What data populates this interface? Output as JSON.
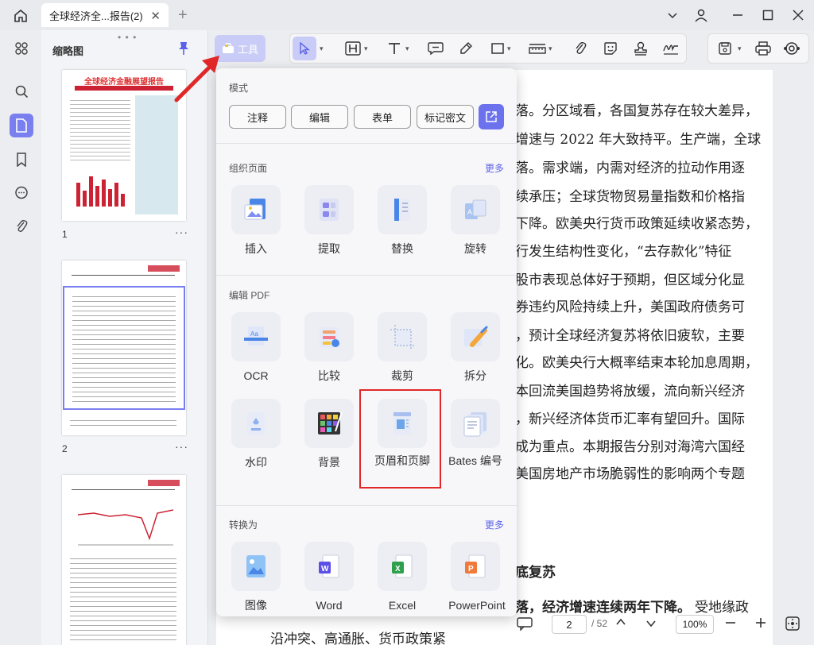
{
  "window": {
    "tab_title": "全球经济全...报告(2)",
    "tab_close": "✕",
    "new_tab": "+"
  },
  "thumbnails": {
    "title": "缩略图",
    "pages": [
      {
        "number": "1",
        "heading": "全球经济金融展望报告"
      },
      {
        "number": "2",
        "heading": ""
      },
      {
        "number": "",
        "heading": ""
      }
    ],
    "more": "···"
  },
  "toolbar": {
    "tools_label": "工具"
  },
  "dropdown": {
    "mode_label": "模式",
    "modes": [
      "注释",
      "编辑",
      "表单",
      "标记密文"
    ],
    "organize": {
      "label": "组织页面",
      "more": "更多",
      "items": [
        "插入",
        "提取",
        "替换",
        "旋转"
      ]
    },
    "edit": {
      "label": "编辑 PDF",
      "items": [
        "OCR",
        "比较",
        "裁剪",
        "拆分",
        "水印",
        "背景",
        "页眉和页脚",
        "Bates 编号"
      ]
    },
    "convert": {
      "label": "转换为",
      "more": "更多",
      "items": [
        "图像",
        "Word",
        "Excel",
        "PowerPoint"
      ]
    }
  },
  "document": {
    "lines": [
      "落。分区域看，各国复苏存在较大差异，",
      "增速与 2022 年大致持平。生产端，全球",
      "落。需求端，内需对经济的拉动作用逐",
      "续承压；全球货物贸易量指数和价格指",
      "下降。欧美央行货币政策延续收紧态势，",
      "行发生结构性变化，“去存款化”特征",
      "股市表现总体好于预期，但区域分化显",
      "券违约风险持续上升，美国政府债务可",
      "，预计全球经济复苏将依旧疲软，主要",
      "化。欧美央行大概率结束本轮加息周期，",
      "本回流美国趋势将放缓，流向新兴经济",
      "，新兴经济体货币汇率有望回升。国际",
      "成为重点。本期报告分别对海湾六国经",
      "美国房地产市场脆弱性的影响两个专题"
    ],
    "heading": "底复苏",
    "bold_line": "落，经济增速连续两年下降。",
    "tail_line": "受地缘政",
    "bottom_line": "沿冲突、高通胀、货币政策紧"
  },
  "navigation": {
    "current_page": "2",
    "total_pages": "/ 52",
    "zoom": "100%"
  },
  "colors": {
    "accent": "#6c72ee",
    "highlight_box": "#e02828",
    "arrow": "#e02828"
  }
}
